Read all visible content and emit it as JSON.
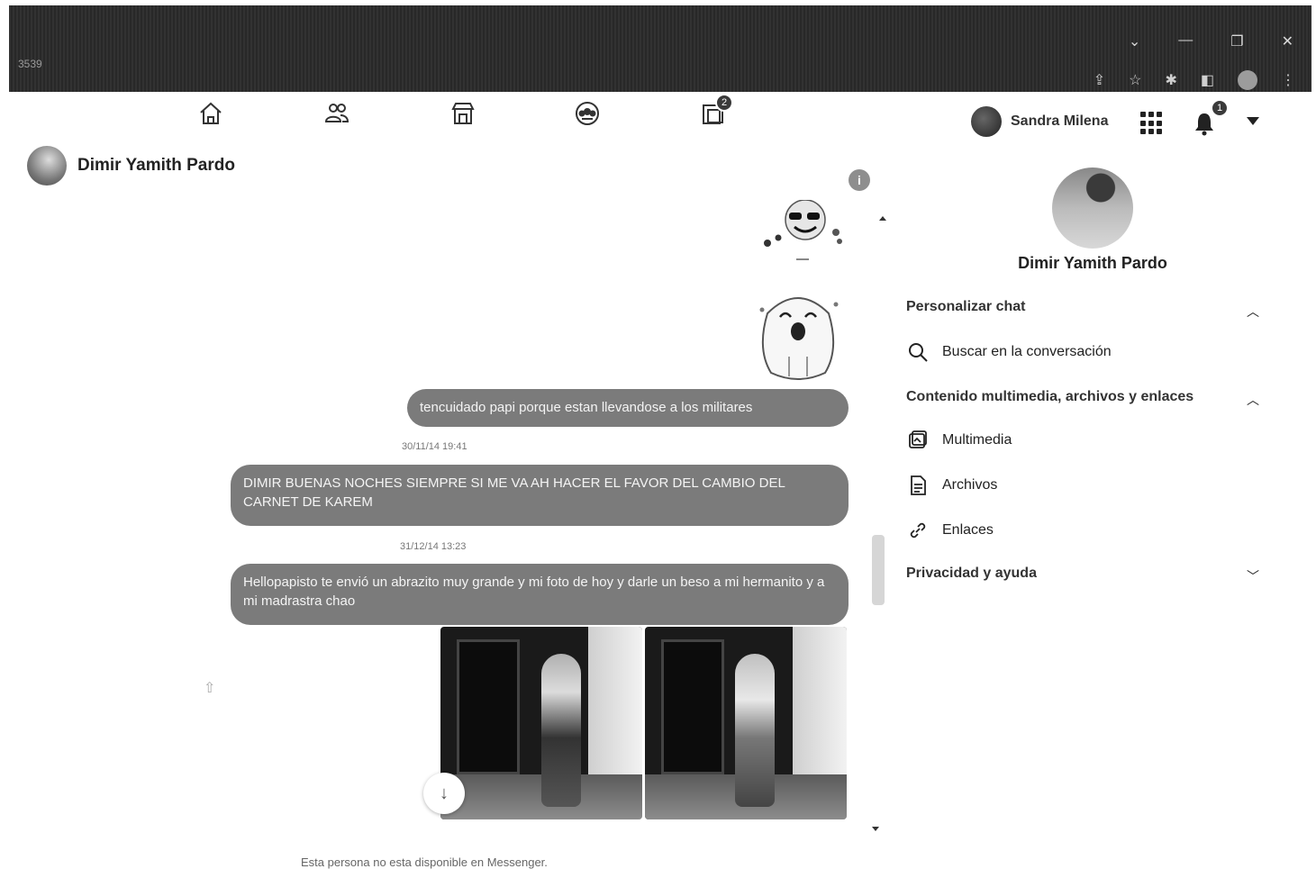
{
  "browser": {
    "tab_fragment": "3539",
    "window_controls": [
      "⌄",
      "—",
      "❐",
      "✕"
    ],
    "toolbar_icons": [
      "share-icon",
      "star-icon",
      "extensions-icon",
      "sidebar-icon",
      "profile-avatar",
      "menu-icon"
    ]
  },
  "topnav": {
    "icons": [
      "home-icon",
      "friends-icon",
      "marketplace-icon",
      "groups-icon",
      "gaming-icon"
    ],
    "gaming_badge": "2",
    "user_name": "Sandra Milena",
    "notifications_badge": "1"
  },
  "chat": {
    "contact_name": "Dimir Yamith Pardo",
    "info_label": "i",
    "messages": [
      {
        "type": "sticker",
        "name": "sunglasses-emoji-sticker"
      },
      {
        "type": "sticker",
        "name": "crying-cat-sticker"
      },
      {
        "type": "text",
        "text": "tencuidado  papi porque  estan  llevandose a los  militares"
      },
      {
        "type": "timestamp",
        "text": "30/11/14 19:41"
      },
      {
        "type": "text",
        "text": "DIMIR BUENAS NOCHES SIEMPRE SI ME VA AH HACER EL FAVOR DEL CAMBIO DEL CARNET DE KAREM"
      },
      {
        "type": "timestamp",
        "text": "31/12/14 13:23"
      },
      {
        "type": "text",
        "text": "Hellopapisto te envió un abrazito muy grande y mi foto de hoy y darle un beso a mi hermanito y a mi madrastra chao"
      },
      {
        "type": "photos",
        "count": 2
      }
    ],
    "download_symbol": "↓",
    "share_symbol": "⇧",
    "footer": "Esta persona no esta disponible en Messenger."
  },
  "panel": {
    "name": "Dimir Yamith Pardo",
    "customize_chat": "Personalizar chat",
    "search": "Buscar en la conversación",
    "media_section": "Contenido multimedia, archivos y enlaces",
    "media": "Multimedia",
    "files": "Archivos",
    "links": "Enlaces",
    "privacy": "Privacidad y ayuda"
  }
}
